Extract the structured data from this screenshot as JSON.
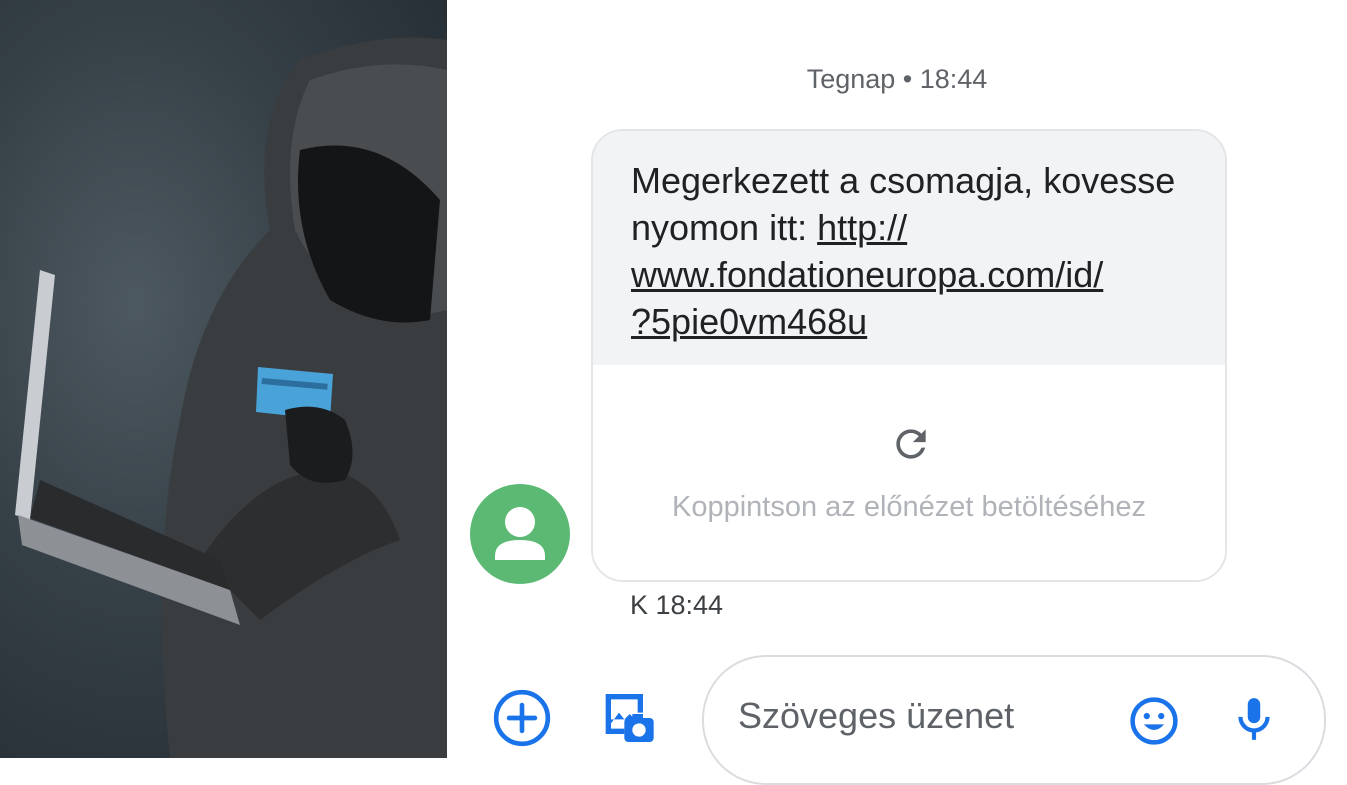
{
  "photo": {
    "subject": "hooded-hacker-with-laptop-and-credit-card"
  },
  "conversation": {
    "date_header": "Tegnap • 18:44",
    "message": {
      "text_before_link": "Megerkezett a csomagja, kovesse nyomon itt: ",
      "link": "http://www.fondationeuropa.com/id/?5pie0vm468u",
      "link_line1": "http://",
      "link_line2": "www.fondationeuropa.com/id/",
      "link_line3": "?5pie0vm468u",
      "preview_hint": "Koppintson az előnézet betöltéséhez",
      "timestamp": "K 18:44"
    },
    "sender_avatar_color": "#5bb974"
  },
  "compose": {
    "placeholder": "Szöveges üzenet",
    "icons": [
      "add-icon",
      "gallery-camera-icon",
      "emoji-icon",
      "mic-icon"
    ],
    "accent_color": "#1a73e8"
  }
}
